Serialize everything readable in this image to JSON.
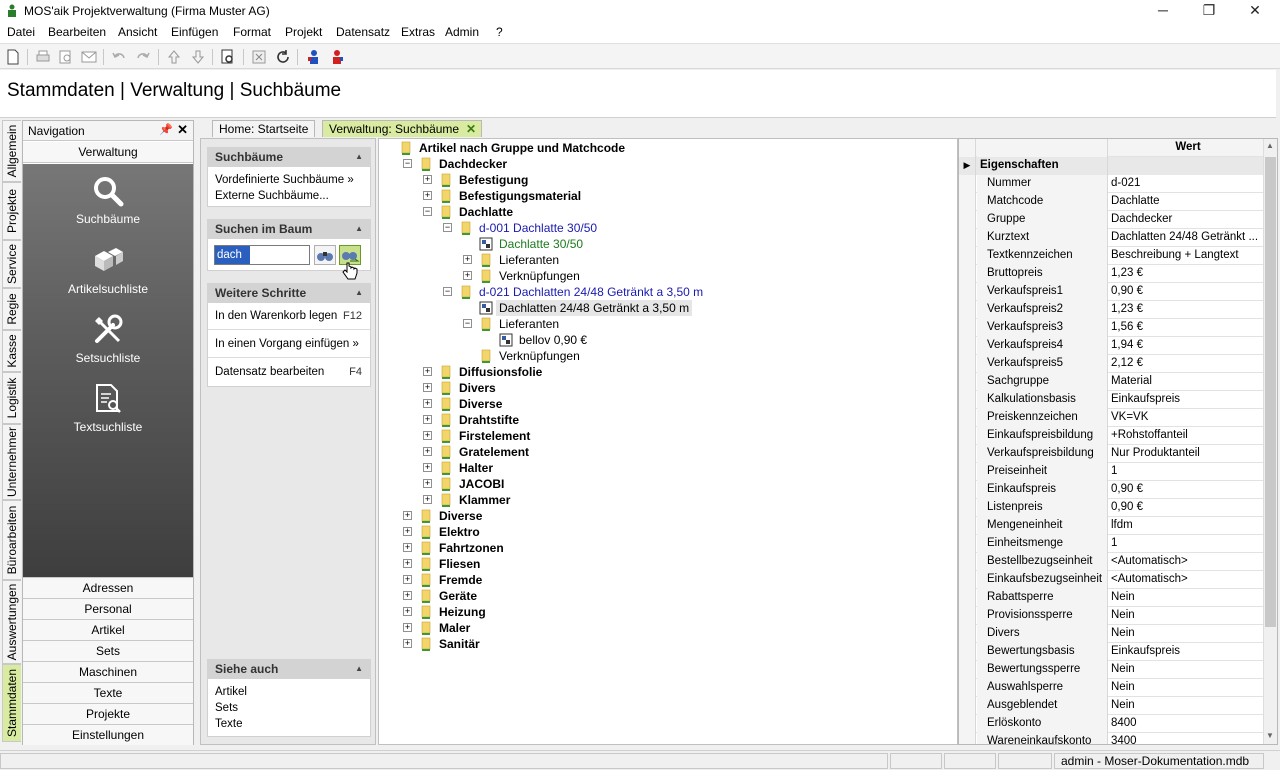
{
  "window": {
    "title": "MOS'aik Projektverwaltung (Firma Muster AG)"
  },
  "menu": [
    "Datei",
    "Bearbeiten",
    "Ansicht",
    "Einfügen",
    "Format",
    "Projekt",
    "Datensatz",
    "Extras",
    "Admin",
    "?"
  ],
  "header": {
    "title": "Stammdaten | Verwaltung | Suchbäume"
  },
  "vtabs": [
    "Allgemein",
    "Projekte",
    "Service",
    "Regie",
    "Kasse",
    "Logistik",
    "Unternehmer",
    "Büroarbeiten",
    "Auswertungen",
    "Stammdaten"
  ],
  "nav": {
    "title": "Navigation",
    "section": "Verwaltung",
    "big_items": [
      "Suchbäume",
      "Artikelsuchliste",
      "Setsuchliste",
      "Textsuchliste"
    ],
    "items": [
      "Adressen",
      "Personal",
      "Artikel",
      "Sets",
      "Maschinen",
      "Texte",
      "Projekte",
      "Einstellungen"
    ]
  },
  "doc_tabs": [
    "Home: Startseite",
    "Verwaltung: Suchbäume"
  ],
  "taskpane": {
    "suchbaeume": {
      "title": "Suchbäume",
      "links": [
        "Vordefinierte Suchbäume »",
        "Externe Suchbäume..."
      ]
    },
    "suchen": {
      "title": "Suchen im Baum",
      "value": "dach"
    },
    "weitere": {
      "title": "Weitere Schritte",
      "links": [
        {
          "label": "In den Warenkorb legen",
          "key": "F12"
        },
        {
          "label": "In einen Vorgang einfügen »",
          "key": ""
        },
        {
          "label": "Datensatz bearbeiten",
          "key": "F4"
        }
      ]
    },
    "siehe": {
      "title": "Siehe auch",
      "links": [
        "Artikel",
        "Sets",
        "Texte"
      ]
    }
  },
  "tree": [
    {
      "label": "Artikel nach Gruppe und Matchcode",
      "lvl": 0,
      "tog": "",
      "icon": "folder",
      "style": "bold"
    },
    {
      "label": "Dachdecker",
      "lvl": 1,
      "tog": "-",
      "icon": "folder",
      "style": "bold"
    },
    {
      "label": "Befestigung",
      "lvl": 2,
      "tog": "+",
      "icon": "folder",
      "style": "bold"
    },
    {
      "label": "Befestigungsmaterial",
      "lvl": 2,
      "tog": "+",
      "icon": "folder",
      "style": "bold"
    },
    {
      "label": "Dachlatte",
      "lvl": 2,
      "tog": "-",
      "icon": "folder",
      "style": "bold"
    },
    {
      "label": "d-001 Dachlatte 30/50",
      "lvl": 3,
      "tog": "-",
      "icon": "folder",
      "style": "blue"
    },
    {
      "label": "Dachlatte 30/50",
      "lvl": 4,
      "tog": "",
      "icon": "item",
      "style": "green"
    },
    {
      "label": "Lieferanten",
      "lvl": 4,
      "tog": "+",
      "icon": "folder",
      "style": ""
    },
    {
      "label": "Verknüpfungen",
      "lvl": 4,
      "tog": "+",
      "icon": "folder",
      "style": ""
    },
    {
      "label": "d-021 Dachlatten 24/48 Getränkt a 3,50 m",
      "lvl": 3,
      "tog": "-",
      "icon": "folder",
      "style": "blue"
    },
    {
      "label": "Dachlatten 24/48 Getränkt a 3,50 m",
      "lvl": 4,
      "tog": "",
      "icon": "item",
      "style": "sel"
    },
    {
      "label": "Lieferanten",
      "lvl": 4,
      "tog": "-",
      "icon": "folder",
      "style": ""
    },
    {
      "label": "bellov 0,90 €",
      "lvl": 5,
      "tog": "",
      "icon": "item",
      "style": ""
    },
    {
      "label": "Verknüpfungen",
      "lvl": 4,
      "tog": "",
      "icon": "folder",
      "style": ""
    },
    {
      "label": "Diffusionsfolie",
      "lvl": 2,
      "tog": "+",
      "icon": "folder",
      "style": "bold"
    },
    {
      "label": "Divers",
      "lvl": 2,
      "tog": "+",
      "icon": "folder",
      "style": "bold"
    },
    {
      "label": "Diverse",
      "lvl": 2,
      "tog": "+",
      "icon": "folder",
      "style": "bold"
    },
    {
      "label": "Drahtstifte",
      "lvl": 2,
      "tog": "+",
      "icon": "folder",
      "style": "bold"
    },
    {
      "label": "Firstelement",
      "lvl": 2,
      "tog": "+",
      "icon": "folder",
      "style": "bold"
    },
    {
      "label": "Gratelement",
      "lvl": 2,
      "tog": "+",
      "icon": "folder",
      "style": "bold"
    },
    {
      "label": "Halter",
      "lvl": 2,
      "tog": "+",
      "icon": "folder",
      "style": "bold"
    },
    {
      "label": "JACOBI",
      "lvl": 2,
      "tog": "+",
      "icon": "folder",
      "style": "bold"
    },
    {
      "label": "Klammer",
      "lvl": 2,
      "tog": "+",
      "icon": "folder",
      "style": "bold"
    },
    {
      "label": "Diverse",
      "lvl": 1,
      "tog": "+",
      "icon": "folder",
      "style": "bold"
    },
    {
      "label": "Elektro",
      "lvl": 1,
      "tog": "+",
      "icon": "folder",
      "style": "bold"
    },
    {
      "label": "Fahrtzonen",
      "lvl": 1,
      "tog": "+",
      "icon": "folder",
      "style": "bold"
    },
    {
      "label": "Fliesen",
      "lvl": 1,
      "tog": "+",
      "icon": "folder",
      "style": "bold"
    },
    {
      "label": "Fremde",
      "lvl": 1,
      "tog": "+",
      "icon": "folder",
      "style": "bold"
    },
    {
      "label": "Geräte",
      "lvl": 1,
      "tog": "+",
      "icon": "folder",
      "style": "bold"
    },
    {
      "label": "Heizung",
      "lvl": 1,
      "tog": "+",
      "icon": "folder",
      "style": "bold"
    },
    {
      "label": "Maler",
      "lvl": 1,
      "tog": "+",
      "icon": "folder",
      "style": "bold"
    },
    {
      "label": "Sanitär",
      "lvl": 1,
      "tog": "+",
      "icon": "folder",
      "style": "bold"
    }
  ],
  "props": {
    "header_value": "Wert",
    "group": "Eigenschaften",
    "rows": [
      [
        "Nummer",
        "d-021"
      ],
      [
        "Matchcode",
        "Dachlatte"
      ],
      [
        "Gruppe",
        "Dachdecker"
      ],
      [
        "Kurztext",
        "Dachlatten 24/48 Getränkt ..."
      ],
      [
        "Textkennzeichen",
        "Beschreibung + Langtext"
      ],
      [
        "Bruttopreis",
        "1,23 €"
      ],
      [
        "Verkaufspreis1",
        "0,90 €"
      ],
      [
        "Verkaufspreis2",
        "1,23 €"
      ],
      [
        "Verkaufspreis3",
        "1,56 €"
      ],
      [
        "Verkaufspreis4",
        "1,94 €"
      ],
      [
        "Verkaufspreis5",
        "2,12 €"
      ],
      [
        "Sachgruppe",
        "Material"
      ],
      [
        "Kalkulationsbasis",
        "Einkaufspreis"
      ],
      [
        "Preiskennzeichen",
        "VK=VK"
      ],
      [
        "Einkaufspreisbildung",
        "+Rohstoffanteil"
      ],
      [
        "Verkaufspreisbildung",
        "Nur Produktanteil"
      ],
      [
        "Preiseinheit",
        "1"
      ],
      [
        "Einkaufspreis",
        "0,90 €"
      ],
      [
        "Listenpreis",
        "0,90 €"
      ],
      [
        "Mengeneinheit",
        "lfdm"
      ],
      [
        "Einheitsmenge",
        "1"
      ],
      [
        "Bestellbezugseinheit",
        "<Automatisch>"
      ],
      [
        "Einkaufsbezugseinheit",
        "<Automatisch>"
      ],
      [
        "Rabattsperre",
        "Nein"
      ],
      [
        "Provisionssperre",
        "Nein"
      ],
      [
        "Divers",
        "Nein"
      ],
      [
        "Bewertungsbasis",
        "Einkaufspreis"
      ],
      [
        "Bewertungssperre",
        "Nein"
      ],
      [
        "Auswahlsperre",
        "Nein"
      ],
      [
        "Ausgeblendet",
        "Nein"
      ],
      [
        "Erlöskonto",
        "8400"
      ],
      [
        "Wareneinkaufskonto",
        "3400"
      ]
    ]
  },
  "status": {
    "text": "admin - Moser-Dokumentation.mdb"
  },
  "colors": {
    "accent": "#d8eba0",
    "folder": "#f2d66b",
    "nav_dark": "#4a4a4a"
  }
}
